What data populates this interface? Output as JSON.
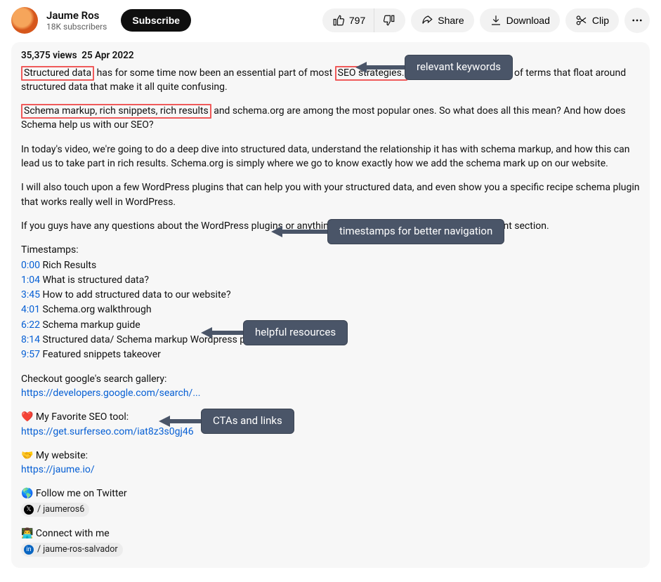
{
  "channel": {
    "name": "Jaume Ros",
    "subscribers": "18K subscribers"
  },
  "header": {
    "subscribe": "Subscribe",
    "likes": "797",
    "share": "Share",
    "download": "Download",
    "clip": "Clip"
  },
  "meta": {
    "views": "35,375 views",
    "date": "25 Apr 2022"
  },
  "desc": {
    "p1a": "Structured data",
    "p1b": " has for some time now been an essential part of most ",
    "p1c": "SEO strategies.",
    "p1d": " However, there are a lot of terms that float around structured data that make it all quite confusing.",
    "p2a": "Schema markup, rich snippets, rich results",
    "p2b": " and schema.org are among the most popular ones. So what does all this mean? And how does Schema help us with our SEO?",
    "p3": "In today's video, we're going to do a deep dive into structured data, understand the relationship it has with schema markup, and how this can lead us to take part in rich results. Schema.org is simply where we go to know exactly how we add the schema mark up on our website.",
    "p4": "I will also touch upon a few WordPress plugins that can help you with your structured data, and even show you a specific recipe schema plugin that works really well in WordPress.",
    "p5": "If you guys have any questions about the WordPress plugins or anything at all, please leave them in the comment section.",
    "ts_label": "Timestamps:",
    "timestamps": [
      {
        "t": "0:00",
        "label": "Rich Results"
      },
      {
        "t": "1:04",
        "label": "What is structured data?"
      },
      {
        "t": "3:45",
        "label": "How to add structured data to our website?"
      },
      {
        "t": "4:01",
        "label": "Schema.org walkthrough"
      },
      {
        "t": "6:22",
        "label": "Schema markup guide"
      },
      {
        "t": "8:14",
        "label": "Structured data/ Schema markup Wordpress plugins"
      },
      {
        "t": "9:57",
        "label": "Featured snippets takeover"
      }
    ],
    "gallery_label": "Checkout google's search gallery:",
    "gallery_link": "https://developers.google.com/search/...",
    "fav_label": "❤️ My Favorite SEO tool:",
    "fav_link": "https://get.surferseo.com/iat8z3s0gj46",
    "site_label": "🤝 My website:",
    "site_link": "https://jaume.io/",
    "twitter_label": "🌎 Follow me on Twitter",
    "twitter_handle": "/ jaumeros6",
    "connect_label": "👨‍💻 Connect with me",
    "linkedin_handle": "/ jaume-ros-salvador"
  },
  "annot": {
    "keywords": "relevant keywords",
    "timestamps": "timestamps for better navigation",
    "resources": "helpful resources",
    "ctas": "CTAs and links"
  }
}
